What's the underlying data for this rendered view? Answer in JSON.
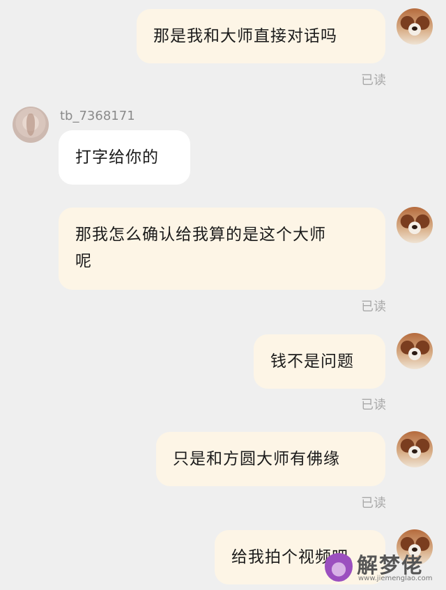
{
  "user": {
    "name": "tb_7368171"
  },
  "read_label": "已读",
  "messages": [
    {
      "side": "mine",
      "text": "那是我和大师直接对话吗"
    },
    {
      "side": "theirs",
      "text": "打字给你的"
    },
    {
      "side": "mine",
      "line1": "那我怎么确认给我算的是这个大师",
      "line2": "呢"
    },
    {
      "side": "mine",
      "text": "钱不是问题"
    },
    {
      "side": "mine",
      "text": "只是和方圆大师有佛缘"
    },
    {
      "side": "mine",
      "text": "给我拍个视频吧"
    }
  ],
  "watermark": {
    "brand": "解梦佬",
    "url": "www.jiemenglao.com"
  }
}
